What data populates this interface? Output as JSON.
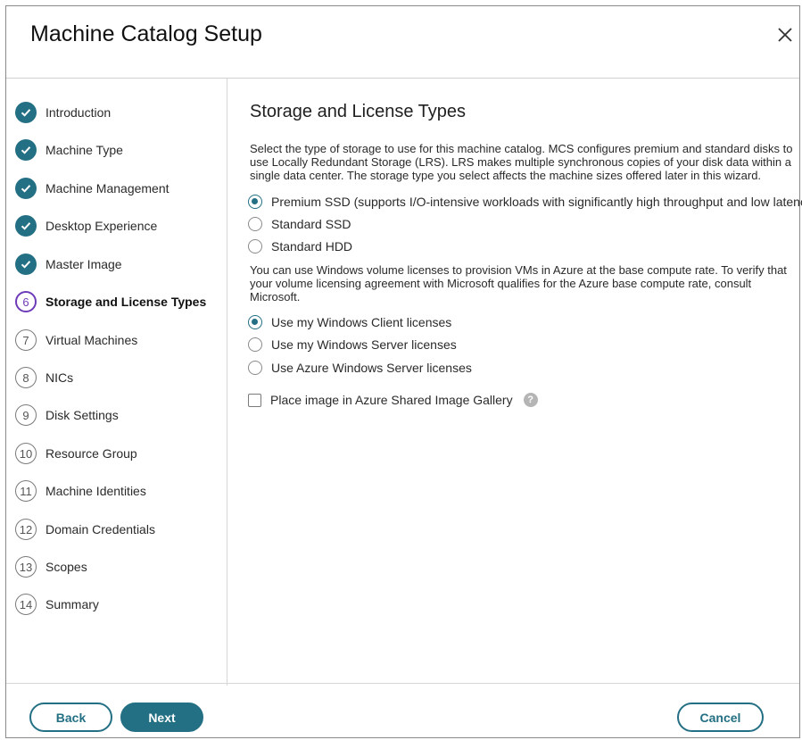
{
  "window": {
    "title": "Machine Catalog Setup"
  },
  "colors": {
    "accent": "#236f83",
    "current_step": "#6e3bb8",
    "help_icon": "#b5b5b5"
  },
  "steps": [
    {
      "label": "Introduction",
      "state": "done",
      "icon": "check-icon"
    },
    {
      "label": "Machine Type",
      "state": "done",
      "icon": "check-icon"
    },
    {
      "label": "Machine Management",
      "state": "done",
      "icon": "check-icon"
    },
    {
      "label": "Desktop Experience",
      "state": "done",
      "icon": "check-icon"
    },
    {
      "label": "Master Image",
      "state": "done",
      "icon": "check-icon"
    },
    {
      "number": "6",
      "label": "Storage and License Types",
      "state": "current"
    },
    {
      "number": "7",
      "label": "Virtual Machines",
      "state": "todo"
    },
    {
      "number": "8",
      "label": "NICs",
      "state": "todo"
    },
    {
      "number": "9",
      "label": "Disk Settings",
      "state": "todo"
    },
    {
      "number": "10",
      "label": "Resource Group",
      "state": "todo"
    },
    {
      "number": "11",
      "label": "Machine Identities",
      "state": "todo"
    },
    {
      "number": "12",
      "label": "Domain Credentials",
      "state": "todo"
    },
    {
      "number": "13",
      "label": "Scopes",
      "state": "todo"
    },
    {
      "number": "14",
      "label": "Summary",
      "state": "todo"
    }
  ],
  "content": {
    "title": "Storage and License Types",
    "storage_description": "Select the type of storage to use for this machine catalog. MCS configures premium and standard disks to use Locally Redundant Storage (LRS). LRS makes multiple synchronous copies of your disk data within a single data center. The storage type you select affects the machine sizes offered later in this wizard.",
    "storage_options": [
      {
        "label": "Premium SSD (supports I/O-intensive workloads with significantly high throughput and low latency)",
        "selected": true
      },
      {
        "label": "Standard SSD",
        "selected": false
      },
      {
        "label": "Standard HDD",
        "selected": false
      }
    ],
    "license_description": "You can use Windows volume licenses to provision VMs in Azure at the base compute rate. To verify that your volume licensing agreement with Microsoft qualifies for the Azure base compute rate, consult Microsoft.",
    "license_options": [
      {
        "label": "Use my Windows Client licenses",
        "selected": true
      },
      {
        "label": "Use my Windows Server licenses",
        "selected": false
      },
      {
        "label": "Use Azure Windows Server licenses",
        "selected": false
      }
    ],
    "gallery_checkbox": {
      "label": "Place image in Azure Shared Image Gallery",
      "checked": false,
      "help_icon": "question-mark-icon",
      "help_glyph": "?"
    }
  },
  "footer": {
    "back_label": "Back",
    "next_label": "Next",
    "cancel_label": "Cancel"
  }
}
